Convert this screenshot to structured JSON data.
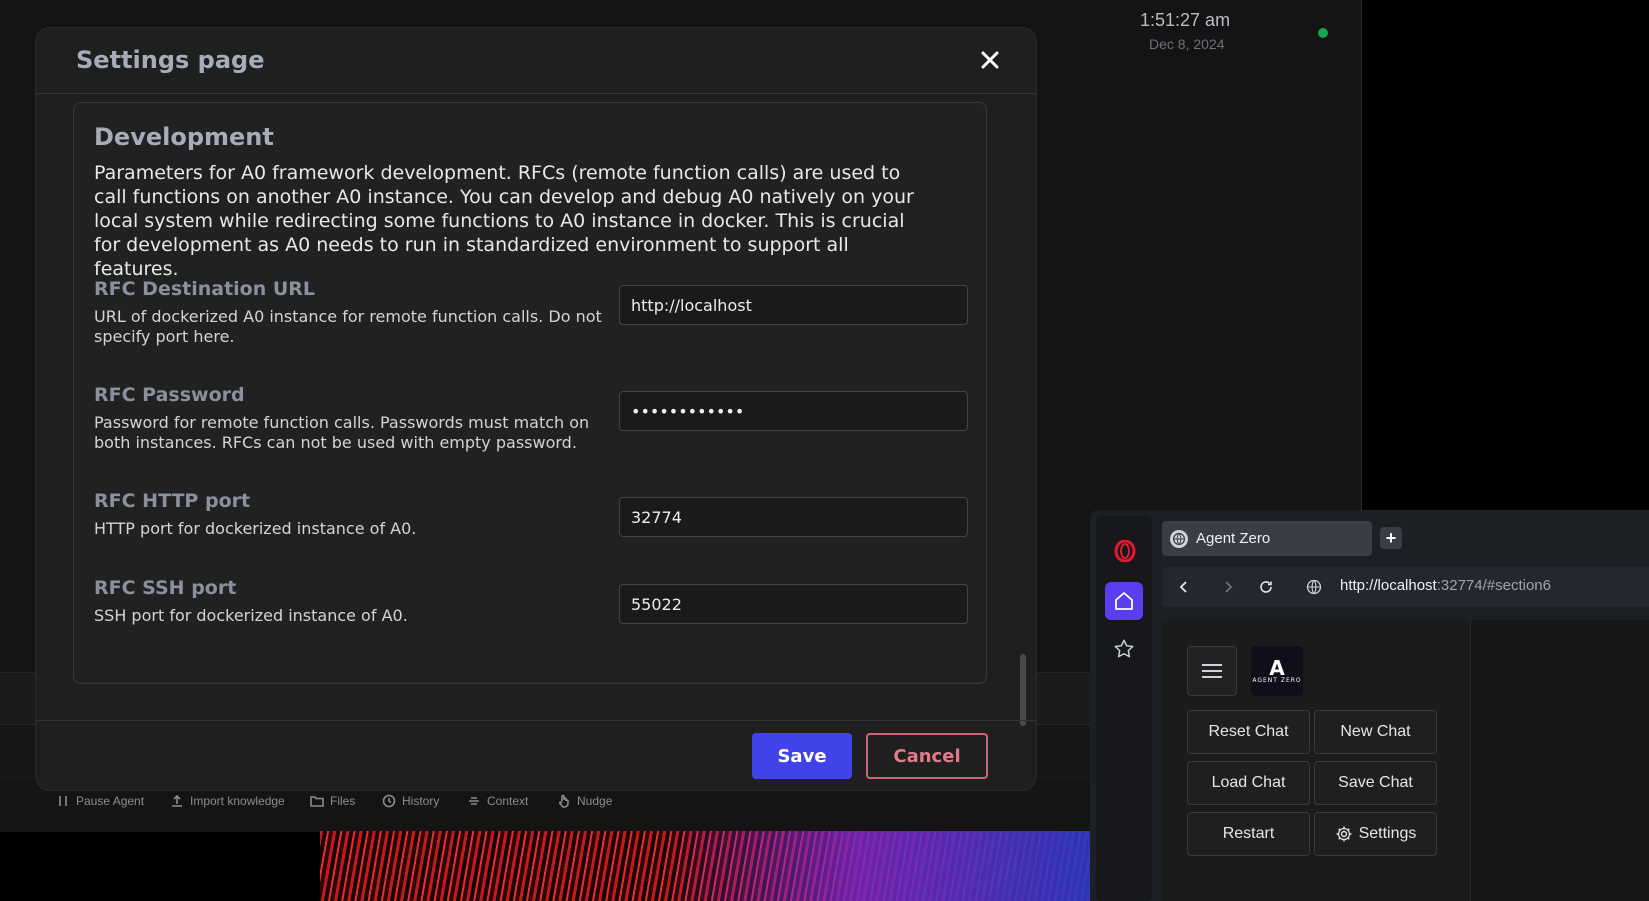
{
  "background_app": {
    "clock_time": "1:51:27 am",
    "clock_date": "Dec 8, 2024",
    "status_color": "#17a34a",
    "bottom_bar": [
      {
        "label": "Pause Agent",
        "icon": "pause-icon"
      },
      {
        "label": "Import knowledge",
        "icon": "upload-icon"
      },
      {
        "label": "Files",
        "icon": "folder-icon"
      },
      {
        "label": "History",
        "icon": "history-icon"
      },
      {
        "label": "Context",
        "icon": "context-icon"
      },
      {
        "label": "Nudge",
        "icon": "hand-pointer-icon"
      }
    ]
  },
  "modal": {
    "title": "Settings page",
    "close_icon": "close-icon",
    "section": {
      "title": "Development",
      "description": "Parameters for A0 framework development. RFCs (remote function calls) are used to call functions on another A0 instance. You can develop and debug A0 natively on your local system while redirecting some functions to A0 instance in docker. This is crucial for development as A0 needs to run in standardized environment to support all features.",
      "fields": [
        {
          "title": "RFC Destination URL",
          "description": "URL of dockerized A0 instance for remote function calls. Do not specify port here.",
          "value": "http://localhost",
          "type": "text"
        },
        {
          "title": "RFC Password",
          "description": "Password for remote function calls. Passwords must match on both instances. RFCs can not be used with empty password.",
          "value": "••••••••••••",
          "type": "password"
        },
        {
          "title": "RFC HTTP port",
          "description": "HTTP port for dockerized instance of A0.",
          "value": "32774",
          "type": "text"
        },
        {
          "title": "RFC SSH port",
          "description": "SSH port for dockerized instance of A0.",
          "value": "55022",
          "type": "text"
        }
      ]
    },
    "save_label": "Save",
    "cancel_label": "Cancel",
    "save_color": "#4143e8",
    "cancel_color": "#e07b8a"
  },
  "browser": {
    "tab_title": "Agent Zero",
    "new_tab_label": "+",
    "url_host": "http://localhost",
    "url_rest": ":32774/#section6",
    "logo_text": "AGENT ZERO",
    "buttons": {
      "reset_chat": "Reset Chat",
      "new_chat": "New Chat",
      "load_chat": "Load Chat",
      "save_chat": "Save Chat",
      "restart": "Restart",
      "settings": "Settings"
    },
    "accent_color": "#5b3df0"
  }
}
